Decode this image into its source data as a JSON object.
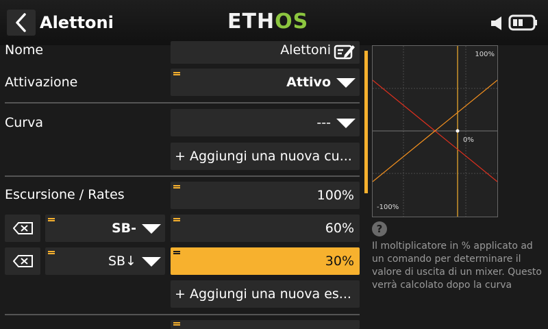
{
  "header": {
    "back_icon": "chevron-left-icon",
    "title": "Alettoni",
    "logo_a": "ETH",
    "logo_b": "OS",
    "logo_color": "#8cc63f",
    "speaker_icon": "speaker-icon",
    "battery_icon": "battery-icon"
  },
  "colors": {
    "accent": "#f7b12e",
    "curve_red": "#e0301e",
    "curve_orange": "#f7921e"
  },
  "form": {
    "nome": {
      "label": "Nome",
      "value": "Alettoni",
      "icon": "edit-icon"
    },
    "attivazione": {
      "label": "Attivazione",
      "value": "Attivo"
    },
    "curva": {
      "label": "Curva",
      "value": "---",
      "add_label": "+ Aggiungi una nuova cu..."
    },
    "rates": {
      "label": "Escursione / Rates",
      "base_value": "100%",
      "rows": [
        {
          "switch": "SB-",
          "value": "60%"
        },
        {
          "switch": "SB↓",
          "value": "30%"
        }
      ],
      "add_label": "+ Aggiungi una nuova es..."
    }
  },
  "graph": {
    "top_label": "100%",
    "mid_label": "0%",
    "bottom_label": "-100%"
  },
  "help": {
    "icon": "?",
    "text": "Il moltiplicatore in % applicato ad un comando per determinare il valore di uscita di un mixer. Questo verrà calcolato dopo la curva"
  }
}
